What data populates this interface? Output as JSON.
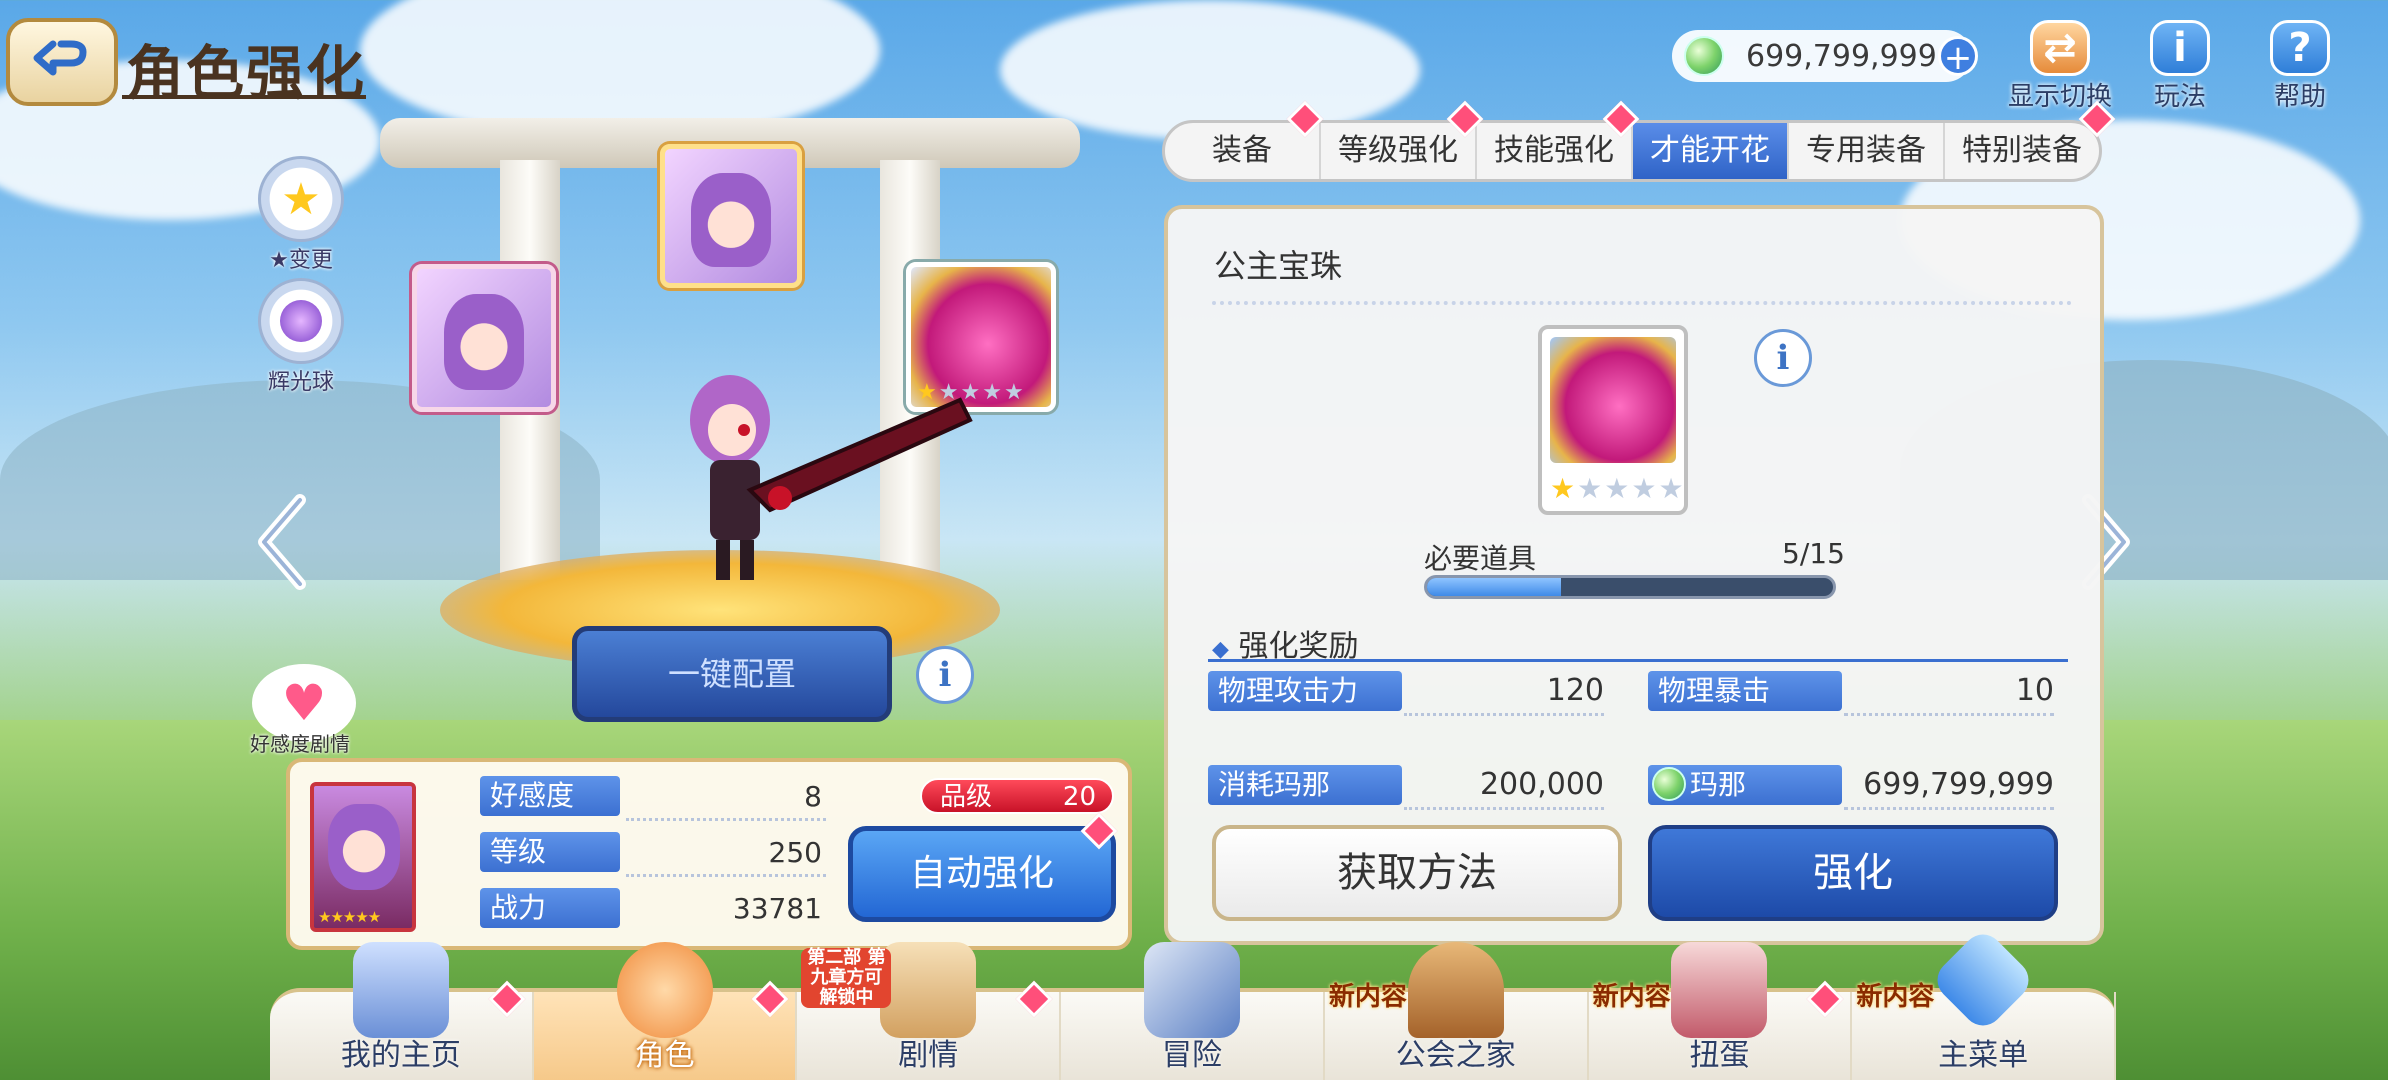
{
  "title": "角色强化",
  "currency": {
    "value": "699,799,999"
  },
  "top_icons": [
    {
      "label": "显示切换"
    },
    {
      "label": "玩法"
    },
    {
      "label": "帮助"
    }
  ],
  "side_buttons": [
    {
      "label": "★变更"
    },
    {
      "label": "辉光球"
    }
  ],
  "onekey_label": "一键配置",
  "affection_label": "好感度剧情",
  "tabs": [
    {
      "label": "装备"
    },
    {
      "label": "等级强化"
    },
    {
      "label": "技能强化"
    },
    {
      "label": "才能开花"
    },
    {
      "label": "专用装备"
    },
    {
      "label": "特别装备"
    }
  ],
  "panel": {
    "title": "公主宝珠",
    "item_stars": 1,
    "item_stars_total": 5,
    "required_label": "必要道具",
    "required_value": "5/15",
    "required_progress": 0.33,
    "reward_title": "强化奖励",
    "stats": [
      {
        "label": "物理攻击力",
        "value": "120"
      },
      {
        "label": "物理暴击",
        "value": "10"
      }
    ],
    "cost_label": "消耗玛那",
    "cost_value": "200,000",
    "mana_label": "玛那",
    "mana_value": "699,799,999",
    "obtain_label": "获取方法",
    "enhance_label": "强化"
  },
  "status": {
    "rows": [
      {
        "label": "好感度",
        "value": "8"
      },
      {
        "label": "等级",
        "value": "250"
      },
      {
        "label": "战力",
        "value": "33781"
      }
    ],
    "rank_label": "品级",
    "rank_value": "20",
    "auto_label": "自动强化",
    "stars": "★★★★★"
  },
  "bottom_nav": [
    {
      "label": "我的主页"
    },
    {
      "label": "角色"
    },
    {
      "label": "剧情",
      "tag": "第二部 第九章方可 解锁中"
    },
    {
      "label": "冒险"
    },
    {
      "label": "公会之家",
      "tag": "新内容"
    },
    {
      "label": "扭蛋",
      "tag": "新内容"
    },
    {
      "label": "主菜单",
      "tag": "新内容"
    }
  ],
  "colors": {
    "accent_blue": "#3c70d1",
    "badge_pink": "#ff4f7a",
    "rank_red": "#c81228"
  }
}
